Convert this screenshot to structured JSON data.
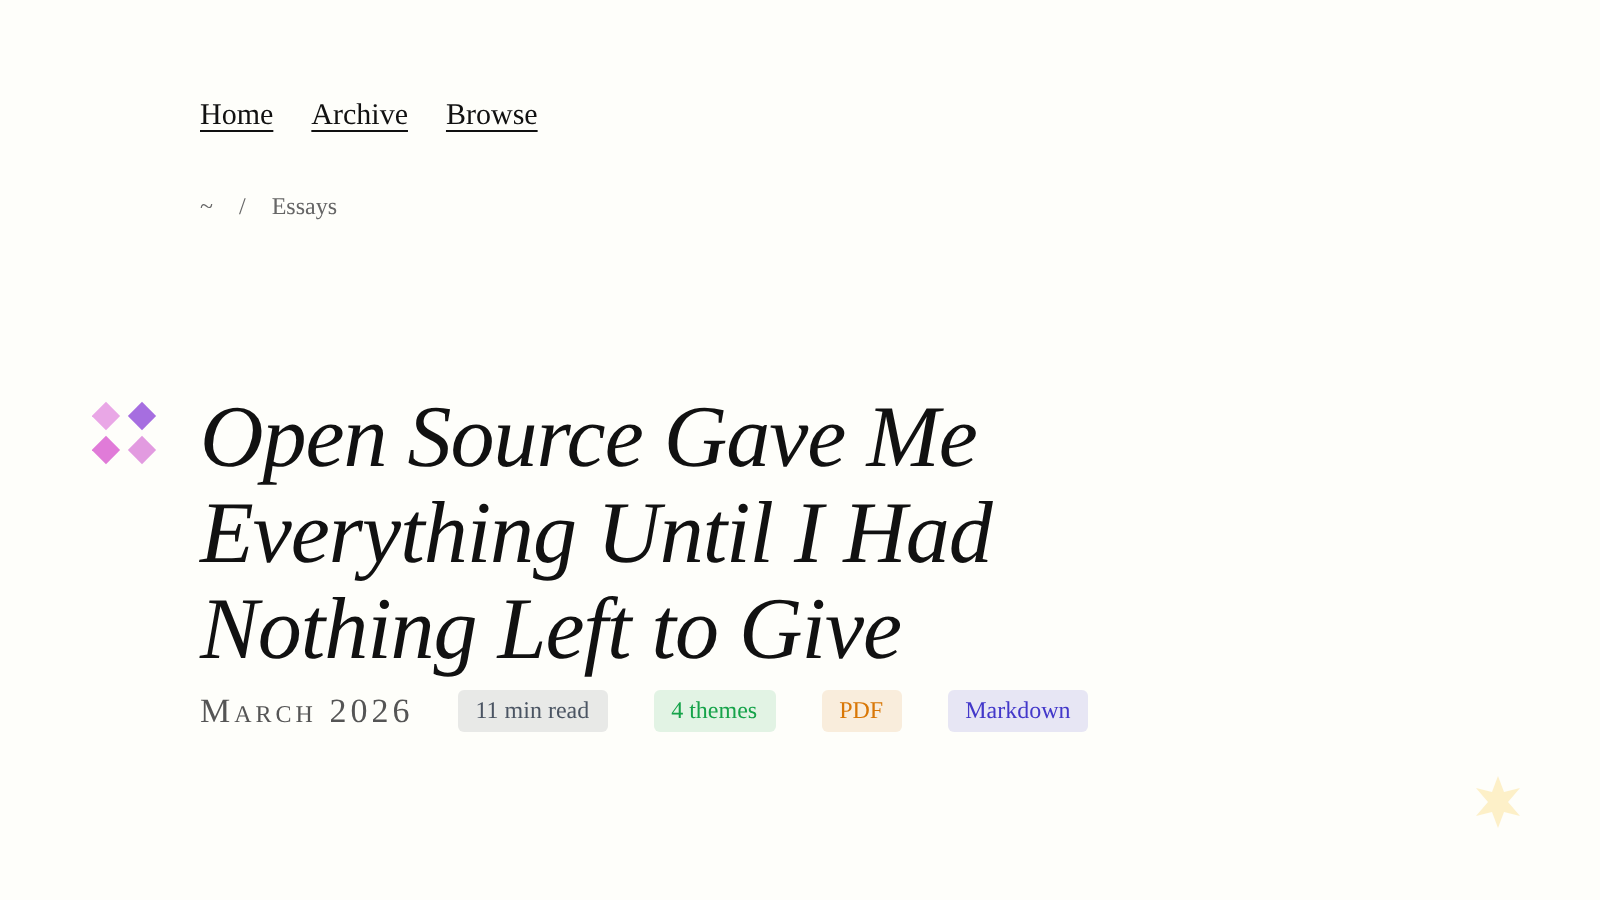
{
  "nav": [
    {
      "label": "Home"
    },
    {
      "label": "Archive"
    },
    {
      "label": "Browse"
    }
  ],
  "breadcrumb": [
    {
      "label": "~"
    },
    {
      "label": "/"
    },
    {
      "label": "Essays"
    }
  ],
  "title": "Open Source Gave Me Everything Until I Had Nothing Left to Give",
  "date": "March 2026",
  "tags": [
    {
      "label": "11 min read",
      "color": "#4b5563"
    },
    {
      "label": "4 themes",
      "color": "#16a34a"
    },
    {
      "label": "PDF",
      "color": "#d97706"
    },
    {
      "label": "Markdown",
      "color": "#4338ca"
    }
  ]
}
